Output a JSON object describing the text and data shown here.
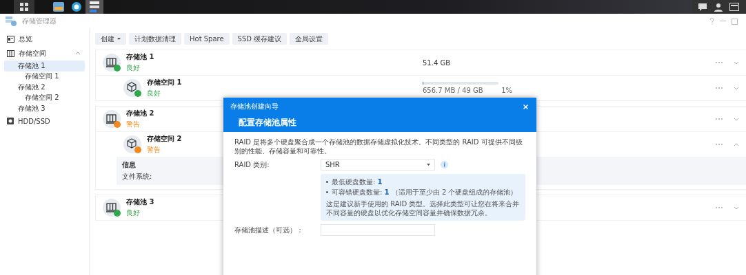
{
  "window": {
    "title": "存储管理器"
  },
  "toolbar": {
    "buttons": [
      {
        "label": "创建",
        "dropdown": true
      },
      {
        "label": "计划数据清理",
        "dropdown": false
      },
      {
        "label": "Hot Spare",
        "dropdown": false
      },
      {
        "label": "SSD 缓存建议",
        "dropdown": false
      },
      {
        "label": "全局设置",
        "dropdown": false
      }
    ]
  },
  "sidebar": {
    "items": [
      {
        "label": "总览",
        "selected": false
      },
      {
        "label": "存储空间",
        "selected": false,
        "expanded": true,
        "children": [
          {
            "label": "存储池 1",
            "selected": true,
            "children": [
              {
                "label": "存储空间 1",
                "selected": false
              }
            ]
          },
          {
            "label": "存储池 2",
            "selected": false,
            "children": [
              {
                "label": "存储空间 2",
                "selected": false
              }
            ]
          },
          {
            "label": "存储池 3",
            "selected": false
          }
        ]
      },
      {
        "label": "HDD/SSD",
        "selected": false
      }
    ]
  },
  "pools": [
    {
      "name": "存储池 1",
      "status": "良好",
      "color": "#2ea84a",
      "size": "51.4 GB",
      "expanded": false,
      "volumes": [
        {
          "name": "存储空间 1",
          "status": "良好",
          "color": "#2ea84a",
          "level": 0.013,
          "usage": "656.7 MB / 49 GB",
          "percent": "1%",
          "expanded": false
        }
      ]
    },
    {
      "name": "存储池 2",
      "status": "警告",
      "color": "#f08a1c",
      "expanded": false,
      "volumes": [
        {
          "name": "存储空间 2",
          "status": "警告",
          "color": "#f08a1c",
          "expanded": true,
          "info": {
            "title": "信息",
            "fields": [
              {
                "label": "文件系统:"
              }
            ]
          }
        }
      ]
    },
    {
      "name": "存储池 3",
      "status": "良好",
      "color": "#2ea84a",
      "expanded": false
    }
  ],
  "dialog": {
    "wizard_title": "存储池创建向导",
    "step_title": "配置存储池属性",
    "description": "RAID 是将多个硬盘聚合成一个存储池的数据存储虚拟化技术。不同类型的 RAID 可提供不同级别的性能、存储容量和可靠性。",
    "raid_type": {
      "label": "RAID 类别:",
      "value": "SHR"
    },
    "info_box": {
      "bullets": [
        "最低硬盘数量: **1**",
        "可容错硬盘数量: **1** （适用于至少由 2 个硬盘组成的存储池）"
      ],
      "text": "这是建议新手使用的 RAID 类型。选择此类型可让您在将来合并不同容量的硬盘以优化存储空间容量并确保数据冗余。"
    },
    "pool_description": {
      "label": "存储池描述（可选）："
    }
  }
}
